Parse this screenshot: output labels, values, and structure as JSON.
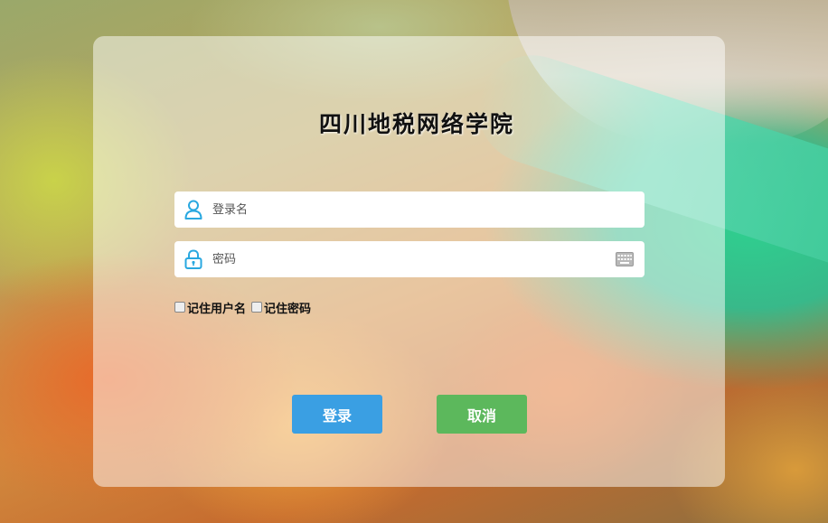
{
  "app": {
    "title": "四川地税网络学院"
  },
  "login_form": {
    "username": {
      "placeholder": "登录名",
      "value": ""
    },
    "password": {
      "placeholder": "密码",
      "value": ""
    },
    "remember_username_label": "记住用户名",
    "remember_password_label": "记住密码",
    "remember_username_checked": false,
    "remember_password_checked": false
  },
  "buttons": {
    "login_label": "登录",
    "cancel_label": "取消"
  },
  "icons": {
    "username": "user-icon",
    "password": "lock-icon",
    "keyboard": "keyboard-icon"
  },
  "colors": {
    "login_button": "#3a9fe3",
    "cancel_button": "#5cb85c",
    "icon_accent": "#29a8e0"
  }
}
